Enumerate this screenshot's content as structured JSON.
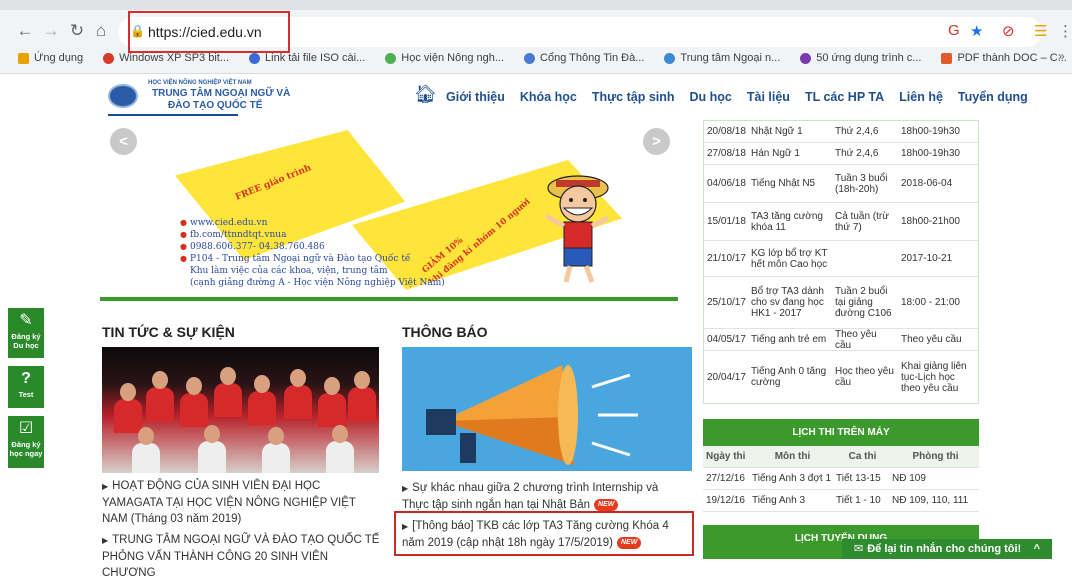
{
  "browser": {
    "url": "https://cied.edu.vn",
    "bookmarks": [
      {
        "label": "Ứng dụng",
        "color": "#e8a200"
      },
      {
        "label": "Windows XP SP3 bit...",
        "color": "#d63a2a"
      },
      {
        "label": "Link tải file ISO cài...",
        "color": "#3a6ad8"
      },
      {
        "label": "Học viện Nông ngh...",
        "color": "#4caf50"
      },
      {
        "label": "Cổng Thông Tin Đà...",
        "color": "#4a7ad0"
      },
      {
        "label": "Trung tâm Ngoại n...",
        "color": "#3b8ad8"
      },
      {
        "label": "50 ứng dụng trình c...",
        "color": "#7a3ab0"
      },
      {
        "label": "PDF thành DOC – C...",
        "color": "#e05a2a"
      }
    ],
    "more_bookmarks": "»"
  },
  "site": {
    "logo_small": "HỌC VIỆN NÔNG NGHIỆP VIỆT NAM",
    "logo_line1": "TRUNG TÂM NGOẠI NGỮ VÀ",
    "logo_line2": "ĐÀO TẠO QUỐC TẾ",
    "menu": [
      "Giới thiệu",
      "Khóa học",
      "Thực tập sinh",
      "Du học",
      "Tài liệu",
      "TL các HP TA",
      "Liên hệ",
      "Tuyển dụng"
    ]
  },
  "banner": {
    "prev": "<",
    "next": ">",
    "free_text": "FREE giáo trình",
    "discount_line1": "GIẢM 10%",
    "discount_line2": "khi đăng kí nhóm 10 người",
    "contacts": [
      "www.cied.edu.vn",
      "fb.com/ttnndtqt.vnua",
      "0988.606.377- 04.38.760.486",
      "P104 - Trung tâm Ngoại ngữ và Đào tạo Quốc tế"
    ],
    "contact_sub1": "Khu làm việc của các khoa, viện, trung tâm",
    "contact_sub2": "(cạnh giảng đường A - Học viện Nông nghiệp Việt Nam)"
  },
  "float_buttons": [
    {
      "label1": "Đăng ký",
      "label2": "Du học"
    },
    {
      "label1": "Test",
      "label2": ""
    },
    {
      "label1": "Đăng ký",
      "label2": "học ngay"
    }
  ],
  "news": {
    "title": "TIN TỨC & SỰ KIỆN",
    "item1": "HOẠT ĐỘNG CỦA SINH VIÊN ĐẠI HỌC YAMAGATA TẠI HỌC VIỆN NÔNG NGHIỆP VIỆT NAM (Tháng 03 năm 2019)",
    "item2": "TRUNG TÂM NGOẠI NGỮ VÀ ĐÀO TẠO QUỐC TẾ PHỎNG VẤN THÀNH CÔNG 20 SINH VIÊN CHƯƠNG"
  },
  "notices": {
    "title": "THÔNG BÁO",
    "item1": "Sự khác nhau giữa 2 chương trình Internship và Thực tập sinh ngắn hạn tại Nhật Bản",
    "item2": "[Thông báo] TKB các lớp TA3 Tăng cường Khóa 4 năm 2019 (cập nhật 18h ngày 17/5/2019)",
    "new_badge": "NEW"
  },
  "schedule": [
    {
      "date": "20/08/18",
      "course": "Nhật Ngữ 1",
      "days": "Thứ 2,4,6",
      "time": "18h00-19h30"
    },
    {
      "date": "27/08/18",
      "course": "Hán Ngữ 1",
      "days": "Thứ 2,4,6",
      "time": "18h00-19h30"
    },
    {
      "date": "04/06/18",
      "course": "Tiếng Nhật N5",
      "days": "Tuần 3 buổi (18h-20h)",
      "time": "2018-06-04"
    },
    {
      "date": "15/01/18",
      "course": "TA3 tăng cường khóa 11",
      "days": "Cả tuần (trừ thứ 7)",
      "time": "18h00-21h00"
    },
    {
      "date": "21/10/17",
      "course": "KG lớp bổ trợ KT hết môn Cao học",
      "days": "",
      "time": "2017-10-21"
    },
    {
      "date": "25/10/17",
      "course": "Bổ trợ TA3 dành cho sv đang học HK1 - 2017",
      "days": "Tuần 2 buổi tại giảng đường C106",
      "time": "18:00 - 21:00"
    },
    {
      "date": "04/05/17",
      "course": "Tiếng anh trẻ em",
      "days": "Theo yêu cầu",
      "time": "Theo yêu cầu"
    },
    {
      "date": "20/04/17",
      "course": "Tiếng Anh 0 tăng cường",
      "days": "Học theo yêu cầu",
      "time": "Khai giảng liên tục-Lịch học theo yêu cầu"
    }
  ],
  "exam": {
    "title": "LỊCH THI TRÊN MÁY",
    "headers": [
      "Ngày thi",
      "Môn thi",
      "Ca thi",
      "Phòng thi"
    ],
    "rows": [
      [
        "27/12/16",
        "Tiếng Anh 3 đợt 1",
        "Tiết 13-15",
        "NĐ 109"
      ],
      [
        "19/12/16",
        "Tiếng Anh 3",
        "Tiết 1 - 10",
        "NĐ 109, 110, 111"
      ]
    ]
  },
  "recruit": {
    "title": "LỊCH TUYỂN DỤNG"
  },
  "chat": {
    "label": "Để lại tin nhắn cho chúng tôi!",
    "up": "^"
  }
}
